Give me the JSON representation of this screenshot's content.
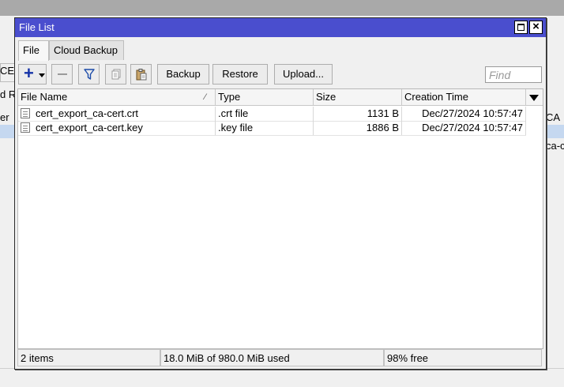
{
  "background": {
    "left_fragments": [
      "CE",
      "d R",
      "er"
    ],
    "right_fragments": [
      "CA",
      "ca-c"
    ]
  },
  "window": {
    "title": "File List"
  },
  "tabs": [
    {
      "label": "File",
      "active": true
    },
    {
      "label": "Cloud Backup",
      "active": false
    }
  ],
  "toolbar": {
    "backup_label": "Backup",
    "restore_label": "Restore",
    "upload_label": "Upload...",
    "find_placeholder": "Find",
    "icons": [
      "plus-icon",
      "minus-icon",
      "filter-icon",
      "copy-icon",
      "paste-icon"
    ]
  },
  "table": {
    "columns": [
      "File Name",
      "Type",
      "Size",
      "Creation Time"
    ],
    "rows": [
      {
        "name": "cert_export_ca-cert.crt",
        "type": ".crt file",
        "size": "1131 B",
        "created": "Dec/27/2024 10:57:47"
      },
      {
        "name": "cert_export_ca-cert.key",
        "type": ".key file",
        "size": "1886 B",
        "created": "Dec/27/2024 10:57:47"
      }
    ]
  },
  "status": {
    "items": "2 items",
    "used": "18.0 MiB of 980.0 MiB used",
    "free": "98% free"
  },
  "colors": {
    "titlebar": "#4a4ece",
    "add_icon": "#1533a8",
    "selection_bg": "#c5d8f0"
  }
}
